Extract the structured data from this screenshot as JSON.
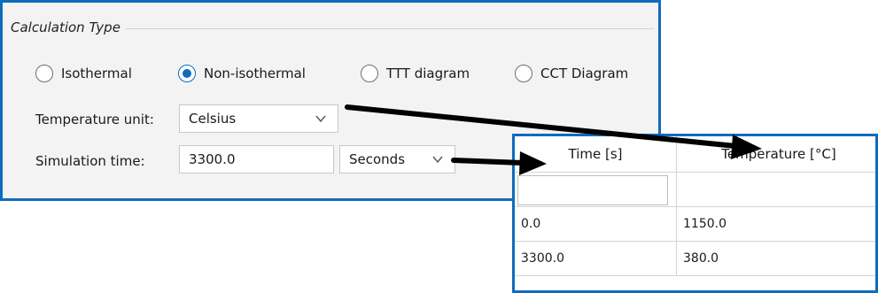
{
  "calc_panel": {
    "group_title": "Calculation Type",
    "radios": [
      {
        "label": "Isothermal",
        "checked": false
      },
      {
        "label": "Non-isothermal",
        "checked": true
      },
      {
        "label": "TTT diagram",
        "checked": false
      },
      {
        "label": "CCT Diagram",
        "checked": false
      }
    ],
    "temperature_unit": {
      "label": "Temperature unit:",
      "value": "Celsius"
    },
    "simulation_time": {
      "label": "Simulation time:",
      "value": "3300.0",
      "unit": "Seconds"
    }
  },
  "table": {
    "headers": [
      "Time [s]",
      "Temperature [°C]"
    ],
    "rows": [
      [
        "",
        ""
      ],
      [
        "0.0",
        "1150.0"
      ],
      [
        "3300.0",
        "380.0"
      ]
    ]
  },
  "colors": {
    "accent": "#0f6cbd",
    "panel_bg": "#f3f3f3"
  }
}
